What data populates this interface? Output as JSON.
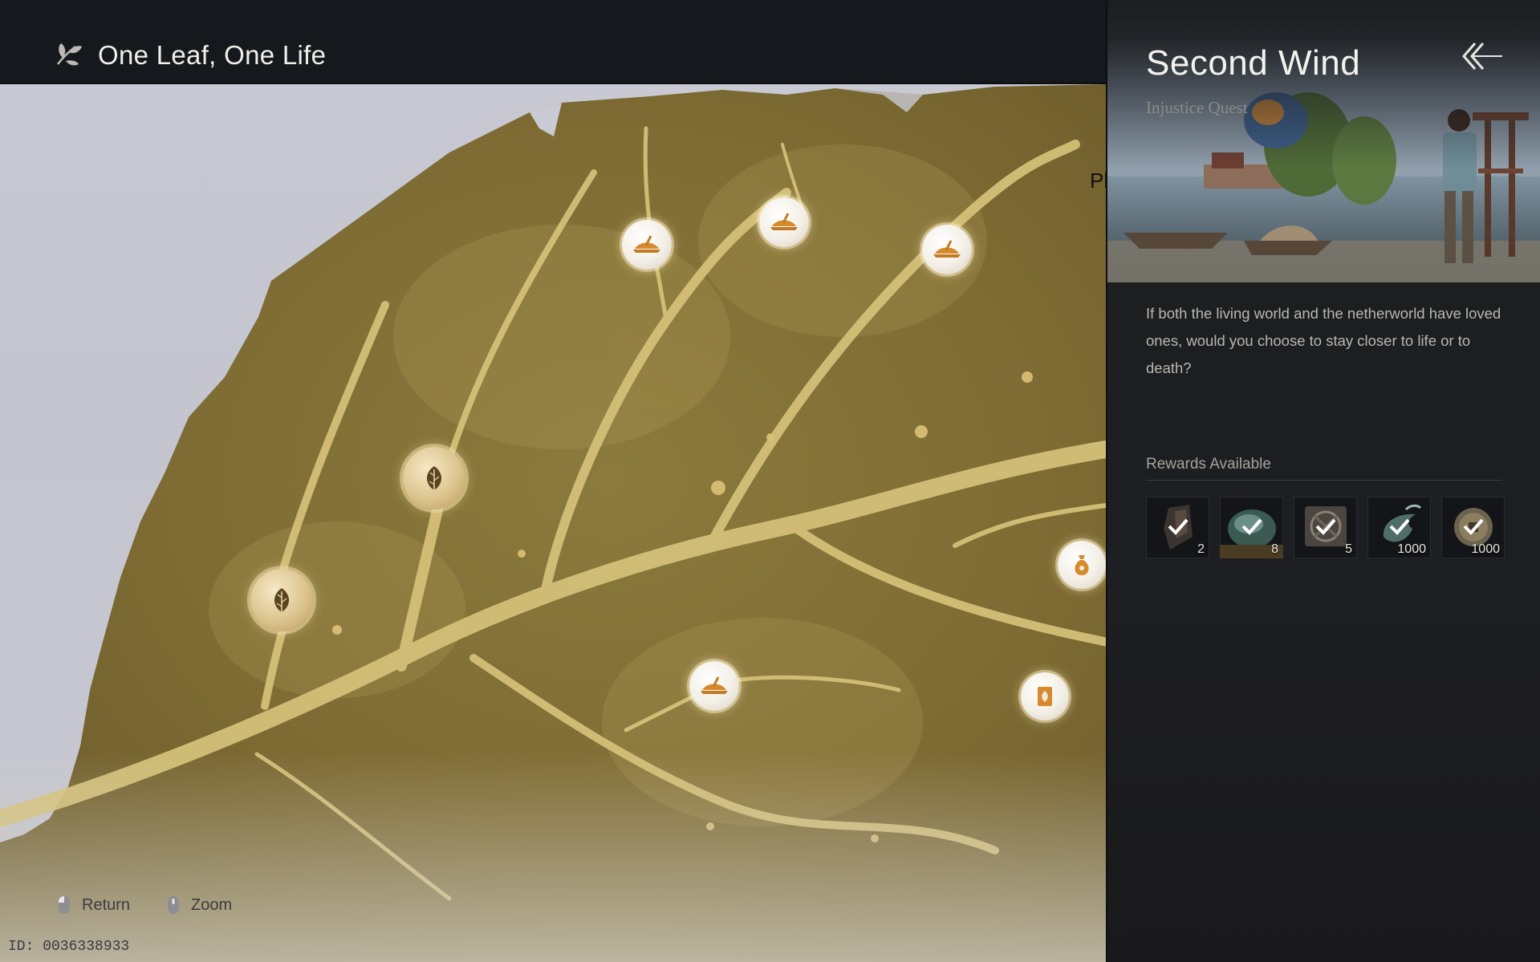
{
  "header": {
    "icon": "leaf-branch-icon",
    "title": "One Leaf, One Life"
  },
  "map": {
    "clipped_label": "Pl",
    "nodes": [
      {
        "name": "quest-node-hat-1",
        "icon": "straw-hat-icon",
        "style": "white"
      },
      {
        "name": "quest-node-hat-2",
        "icon": "straw-hat-icon",
        "style": "white"
      },
      {
        "name": "quest-node-hat-3",
        "icon": "straw-hat-icon",
        "style": "white"
      },
      {
        "name": "quest-node-leaf-1",
        "icon": "leaf-icon",
        "style": "gold"
      },
      {
        "name": "quest-node-leaf-2",
        "icon": "leaf-icon",
        "style": "gold"
      },
      {
        "name": "quest-node-hat-4",
        "icon": "straw-hat-icon",
        "style": "white"
      },
      {
        "name": "quest-node-pouch",
        "icon": "money-pouch-icon",
        "style": "white"
      },
      {
        "name": "quest-node-card",
        "icon": "scroll-card-icon",
        "style": "white"
      }
    ]
  },
  "footer": {
    "return_label": "Return",
    "zoom_label": "Zoom",
    "id_text": "ID: 0036338933"
  },
  "panel": {
    "title": "Second Wind",
    "subtitle": "Injustice Quest",
    "description": "If both the living world and the netherworld have loved ones, would you choose to stay closer to life or to death?",
    "rewards_label": "Rewards Available",
    "rewards": [
      {
        "icon": "dark-shard-icon",
        "qty": "2",
        "claimed": true
      },
      {
        "icon": "jade-stone-icon",
        "qty": "8",
        "claimed": true
      },
      {
        "icon": "bronze-seal-icon",
        "qty": "5",
        "claimed": true
      },
      {
        "icon": "spirit-wisp-icon",
        "qty": "1000",
        "claimed": true
      },
      {
        "icon": "coin-icon",
        "qty": "1000",
        "claimed": true
      }
    ]
  },
  "colors": {
    "leaf_gold": "#8f7a3c",
    "vein_gold": "#d9c479",
    "panel_bg": "#1d1e21",
    "header_bg": "#15181c"
  }
}
